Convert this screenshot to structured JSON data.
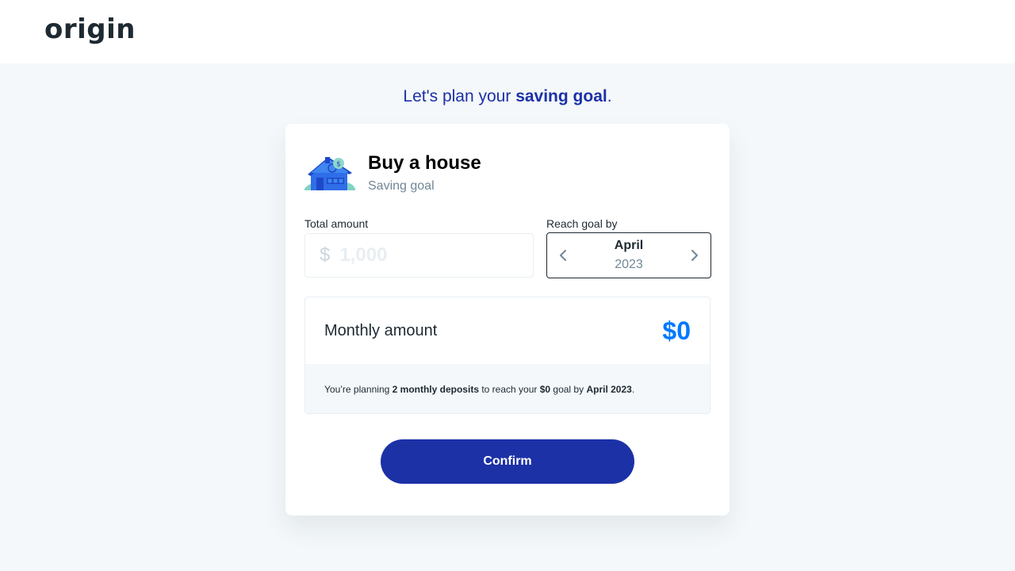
{
  "header": {
    "logo": "origin"
  },
  "headline": {
    "prefix": "Let's plan your ",
    "highlight": "saving goal",
    "suffix": "."
  },
  "goal": {
    "title": "Buy a house",
    "subtitle": "Saving goal",
    "icon": "house-icon"
  },
  "amount": {
    "label": "Total amount",
    "currency": "$",
    "placeholder": "1,000",
    "value": ""
  },
  "reach": {
    "label": "Reach goal by",
    "month": "April",
    "year": "2023",
    "prev_icon": "chevron-left-icon",
    "next_icon": "chevron-right-icon"
  },
  "summary": {
    "monthly_label": "Monthly amount",
    "monthly_value": "$0",
    "text_1": "You’re planning ",
    "deposits": "2 monthly deposits",
    "text_2": " to reach your ",
    "goal_amount": "$0",
    "text_3": " goal by ",
    "goal_date": "April 2023",
    "text_4": "."
  },
  "confirm_label": "Confirm",
  "colors": {
    "primary": "#1C31A6",
    "accent": "#0079FF",
    "background": "#F4F8FA",
    "muted": "#708797"
  }
}
